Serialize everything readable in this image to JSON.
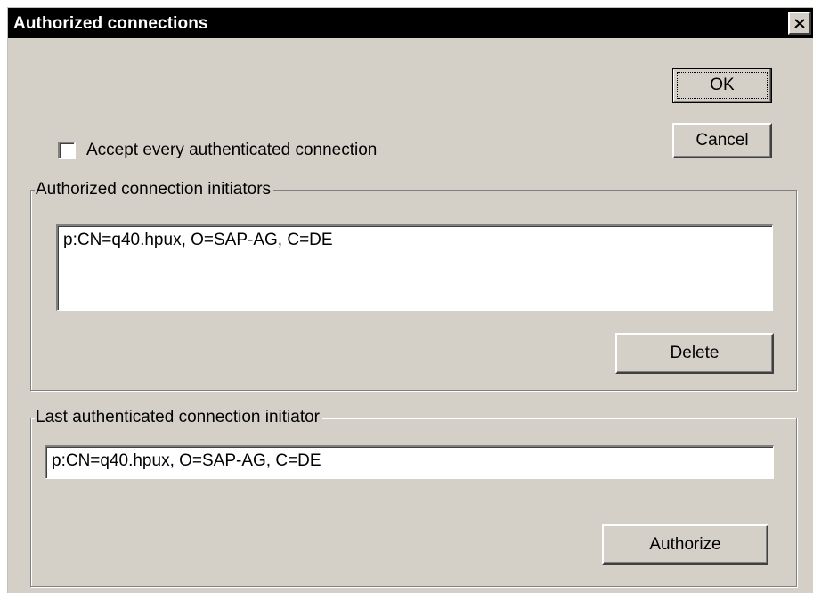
{
  "window": {
    "title": "Authorized connections"
  },
  "buttons": {
    "ok": "OK",
    "cancel": "Cancel",
    "delete": "Delete",
    "authorize": "Authorize"
  },
  "accept_checkbox": {
    "label": "Accept every authenticated connection",
    "checked": false
  },
  "authorized_group": {
    "legend": "Authorized connection initiators",
    "items": [
      "p:CN=q40.hpux, O=SAP-AG, C=DE"
    ]
  },
  "last_group": {
    "legend": "Last authenticated connection initiator",
    "value": "p:CN=q40.hpux, O=SAP-AG, C=DE"
  },
  "colors": {
    "titlebar": "#000000",
    "face": "#d4d0c8",
    "field": "#ffffff"
  }
}
